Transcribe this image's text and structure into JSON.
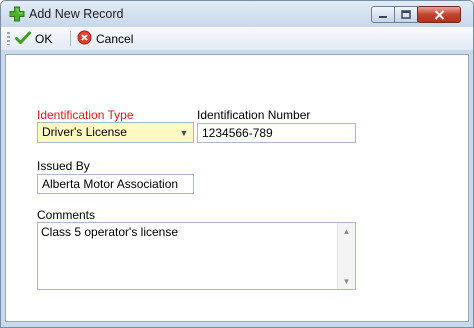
{
  "window": {
    "title": "Add New Record",
    "icons": {
      "title": "plus-icon",
      "minimize": "minimize-icon",
      "maximize": "maximize-icon",
      "close": "close-icon"
    }
  },
  "toolbar": {
    "ok_label": "OK",
    "cancel_label": "Cancel",
    "icons": {
      "ok": "checkmark-icon",
      "cancel": "cancel-icon"
    }
  },
  "form": {
    "identification_type": {
      "label": "Identification Type",
      "value": "Driver's License"
    },
    "identification_number": {
      "label": "Identification Number",
      "value": "1234566-789"
    },
    "issued_by": {
      "label": "Issued By",
      "value": "Alberta Motor Association"
    },
    "comments": {
      "label": "Comments",
      "value": "Class 5 operator's license"
    }
  },
  "colors": {
    "required_label": "#e01b1b",
    "combo_background": "#fff9c4",
    "window_frame": "#c9d9ec"
  }
}
